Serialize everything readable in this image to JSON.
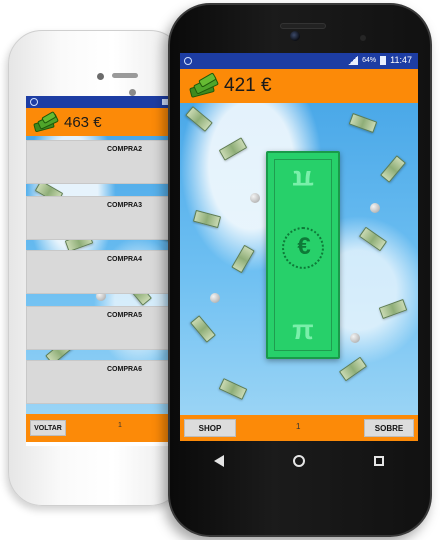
{
  "back_phone": {
    "balance": "463 €",
    "buy_items": [
      "COMPRA2",
      "COMPRA3",
      "COMPRA4",
      "COMPRA5",
      "COMPRA6"
    ],
    "back_button": "VOLTAR",
    "page_number": "1"
  },
  "front_phone": {
    "status": {
      "battery_percent": "64%",
      "time": "11:47"
    },
    "balance": "421 €",
    "shop_button": "SHOP",
    "about_button": "SOBRE",
    "page_number": "1"
  },
  "colors": {
    "status_bar": "#1d3da3",
    "app_bar": "#fc8a08",
    "button": "#dcdcdc",
    "note": "#27d06a"
  },
  "icons": [
    "money-stack-icon",
    "euro-banknote",
    "back-icon",
    "home-icon",
    "recents-icon"
  ]
}
